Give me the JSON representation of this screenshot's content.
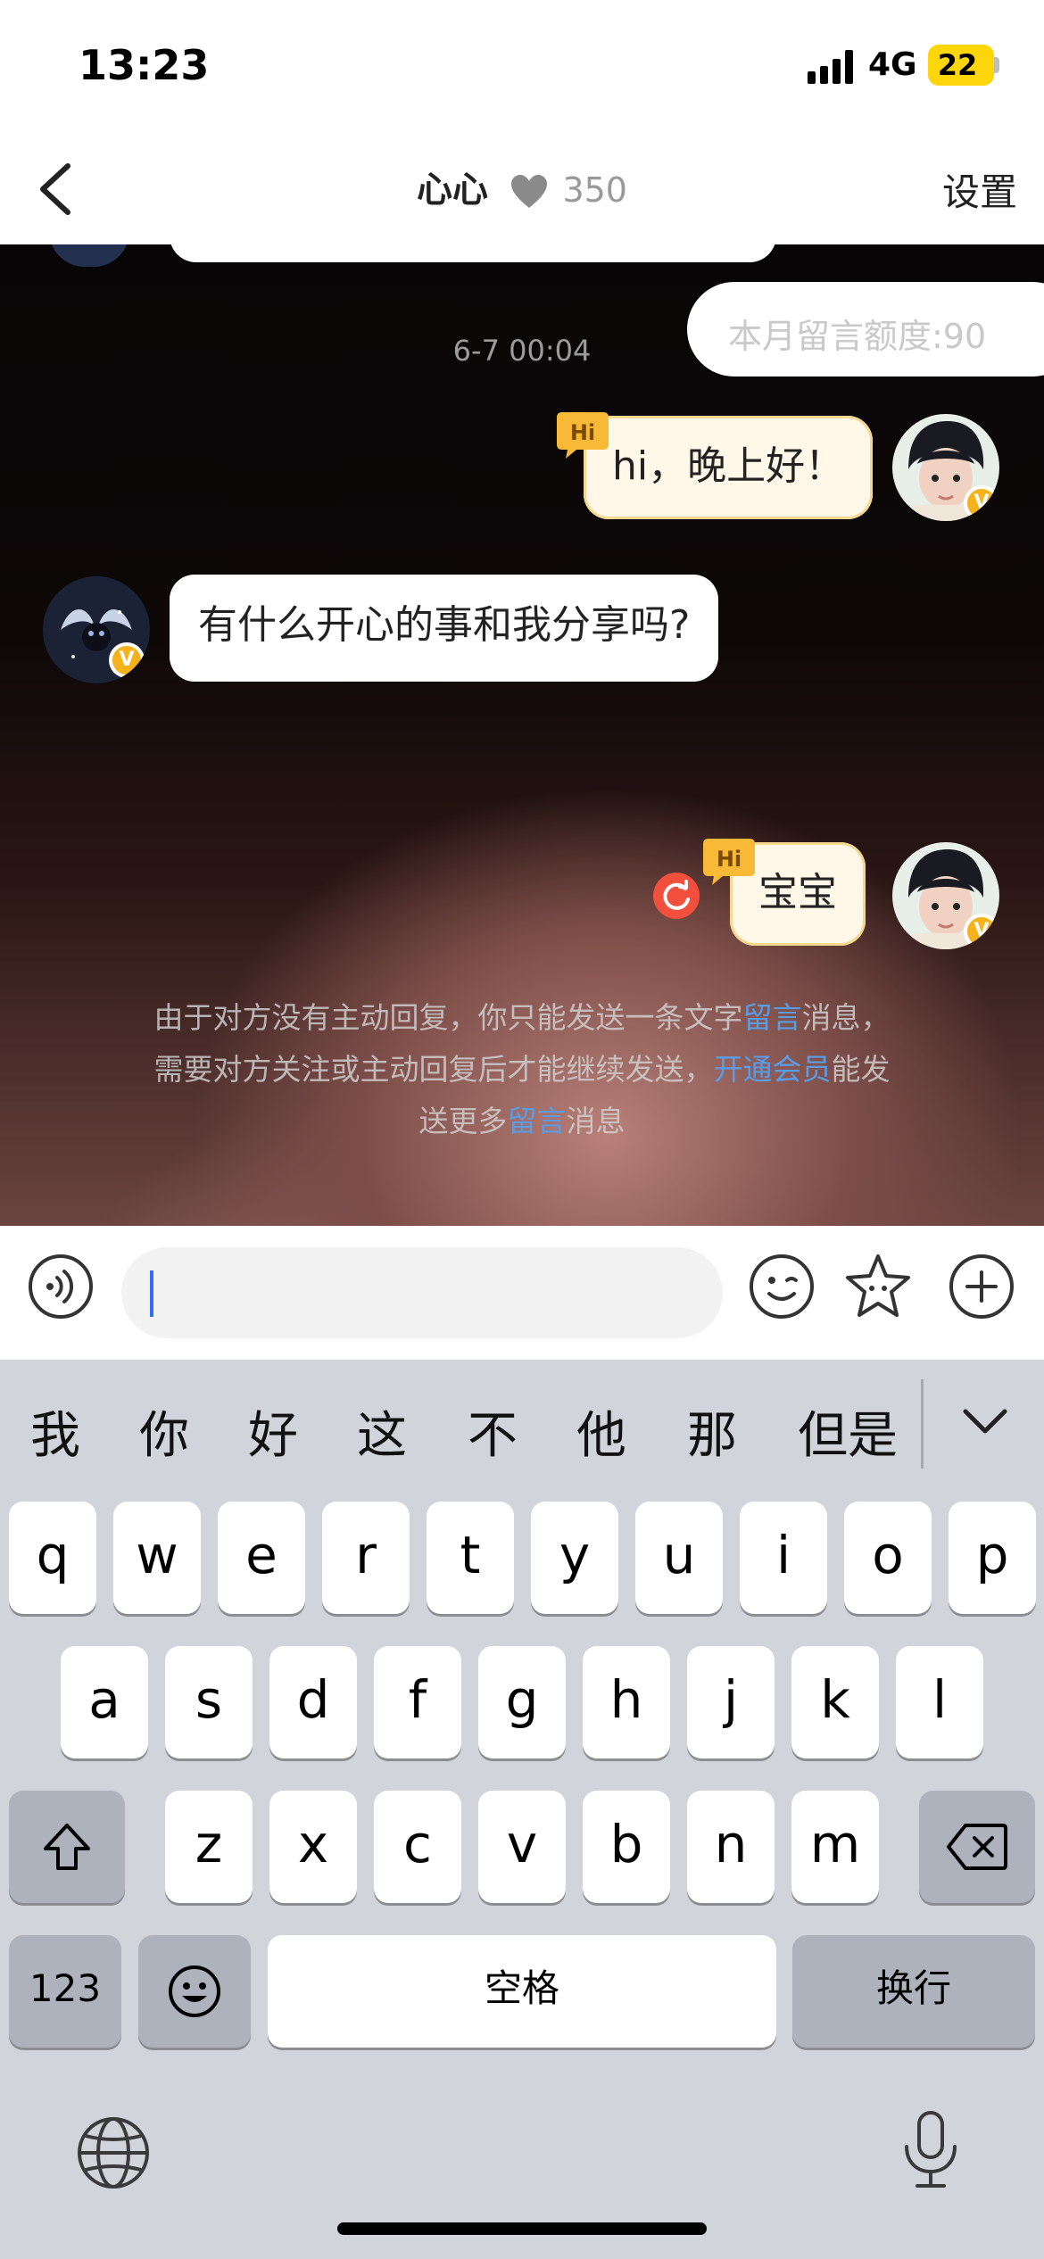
{
  "status_bar": {
    "time": "13:23",
    "network": "4G",
    "battery": "22"
  },
  "header": {
    "title": "心心",
    "score": "350",
    "settings_label": "设置"
  },
  "chat": {
    "quota_text": "本月留言额度:90",
    "timestamp": "6-7 00:04",
    "messages": [
      {
        "direction": "out",
        "text": "hi，晚上好！",
        "badge": "Hi"
      },
      {
        "direction": "in",
        "text": "有什么开心的事和我分享吗?"
      },
      {
        "direction": "out",
        "text": "宝宝",
        "badge": "Hi",
        "status": "resend"
      }
    ],
    "notice": {
      "line1_a": "由于对方没有主动回复，你只能发送一条文字",
      "line1_link": "留言",
      "line1_b": "消息，",
      "line2_a": "需要对方关注或主动回复后才能继续发送，",
      "line2_link": "开通会员",
      "line2_b": "能发",
      "line3_a": "送更多",
      "line3_link": "留言",
      "line3_b": "消息"
    },
    "badge_letter": "V"
  },
  "input_bar": {
    "placeholder": ""
  },
  "keyboard": {
    "candidates": [
      "我",
      "你",
      "好",
      "这",
      "不",
      "他",
      "那",
      "但是"
    ],
    "row1": [
      "q",
      "w",
      "e",
      "r",
      "t",
      "y",
      "u",
      "i",
      "o",
      "p"
    ],
    "row2": [
      "a",
      "s",
      "d",
      "f",
      "g",
      "h",
      "j",
      "k",
      "l"
    ],
    "row3": [
      "z",
      "x",
      "c",
      "v",
      "b",
      "n",
      "m"
    ],
    "numbers_label": "123",
    "space_label": "空格",
    "return_label": "换行"
  },
  "colors": {
    "accent_link": "#5a9ce6",
    "caret": "#2f6ef2",
    "badge": "#f5b21b",
    "resend": "#f2503c",
    "keyboard_bg": "#d1d4db"
  },
  "icons": [
    "back-icon",
    "heart-icon",
    "voice-icon",
    "emoji-icon",
    "sticker-icon",
    "plus-icon",
    "shift-icon",
    "delete-icon",
    "globe-icon",
    "mic-icon",
    "chevron-down-icon",
    "resend-icon",
    "hi-icon"
  ]
}
